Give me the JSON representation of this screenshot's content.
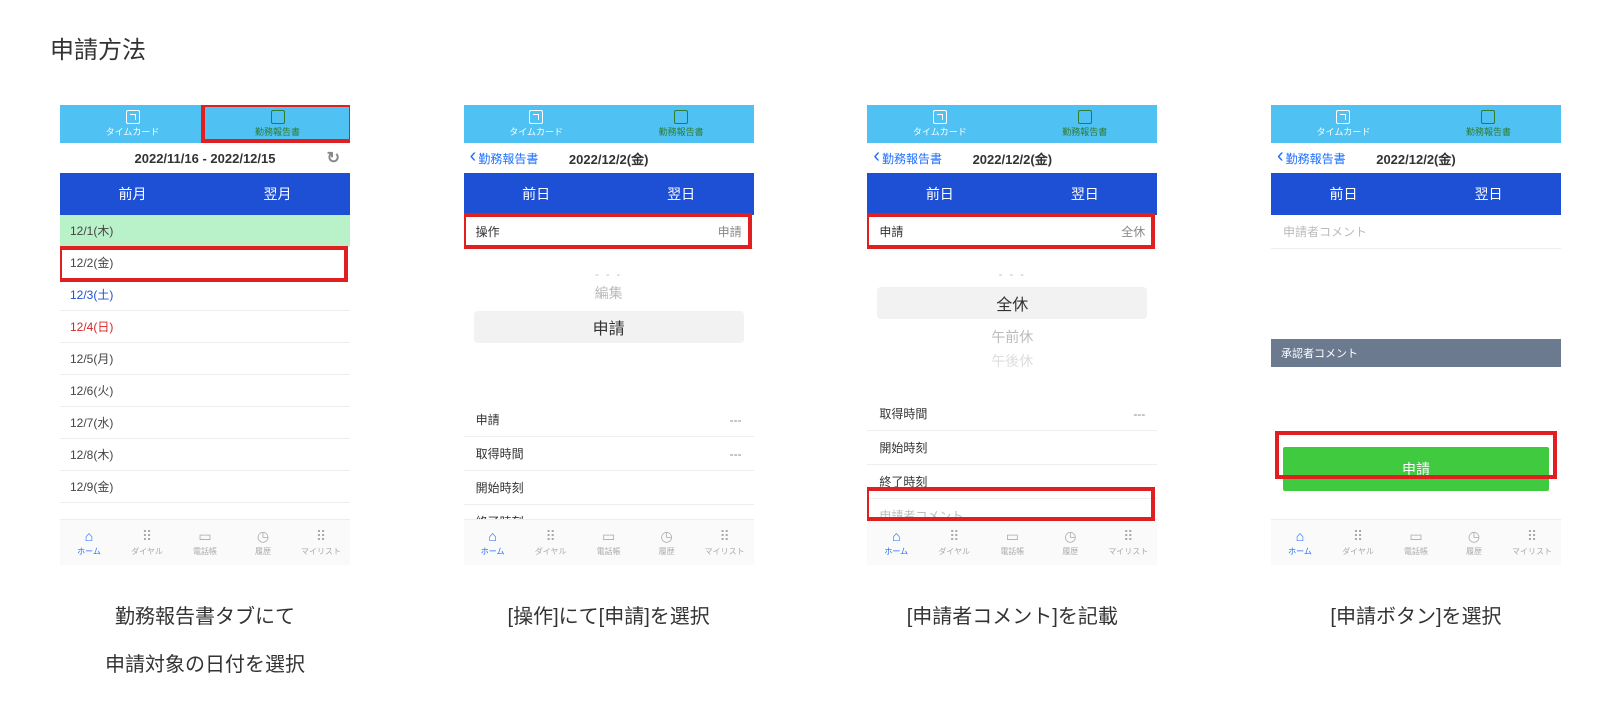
{
  "title": "申請方法",
  "tabs": {
    "left": "タイムカード",
    "right": "勤務報告書"
  },
  "dock": {
    "items": [
      {
        "label": "ホーム"
      },
      {
        "label": "ダイヤル"
      },
      {
        "label": "電話帳"
      },
      {
        "label": "履歴"
      },
      {
        "label": "マイリスト"
      }
    ]
  },
  "p1": {
    "date_range": "2022/11/16 - 2022/12/15",
    "nav_prev": "前月",
    "nav_next": "翌月",
    "rows": [
      {
        "text": "12/1(木)",
        "cls": "holiday"
      },
      {
        "text": "12/2(金)",
        "cls": ""
      },
      {
        "text": "12/3(土)",
        "cls": "sat"
      },
      {
        "text": "12/4(日)",
        "cls": "sun"
      },
      {
        "text": "12/5(月)",
        "cls": ""
      },
      {
        "text": "12/6(火)",
        "cls": ""
      },
      {
        "text": "12/7(水)",
        "cls": ""
      },
      {
        "text": "12/8(木)",
        "cls": ""
      },
      {
        "text": "12/9(金)",
        "cls": ""
      }
    ],
    "caption": "勤務報告書タブにて\n申請対象の日付を選択"
  },
  "p2": {
    "back": "勤務報告書",
    "date": "2022/12/2(金)",
    "nav_prev": "前日",
    "nav_next": "翌日",
    "op_label": "操作",
    "op_value": "申請",
    "picker_edit": "編集",
    "picker_apply": "申請",
    "fields": [
      {
        "label": "申請",
        "value": "---"
      },
      {
        "label": "取得時間",
        "value": "---"
      },
      {
        "label": "開始時刻",
        "value": ""
      },
      {
        "label": "終了時刻",
        "value": ""
      }
    ],
    "caption": "[操作]にて[申請]を選択"
  },
  "p3": {
    "back": "勤務報告書",
    "date": "2022/12/2(金)",
    "nav_prev": "前日",
    "nav_next": "翌日",
    "op_label": "申請",
    "op_value": "全休",
    "picker_main": "全休",
    "picker_am": "午前休",
    "picker_pm": "午後休",
    "fields": [
      {
        "label": "取得時間",
        "value": "---"
      },
      {
        "label": "開始時刻",
        "value": ""
      },
      {
        "label": "終了時刻",
        "value": ""
      }
    ],
    "comment_placeholder": "申請者コメント",
    "caption": "[申請者コメント]を記載"
  },
  "p4": {
    "back": "勤務報告書",
    "date": "2022/12/2(金)",
    "nav_prev": "前日",
    "nav_next": "翌日",
    "comment_placeholder": "申請者コメント",
    "approver_label": "承認者コメント",
    "submit_label": "申請",
    "caption": "[申請ボタン]を選択"
  }
}
